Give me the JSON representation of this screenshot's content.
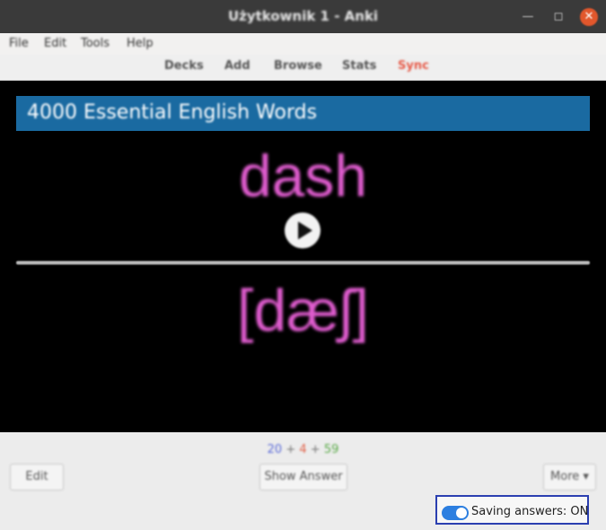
{
  "window": {
    "title": "Użytkownik 1 - Anki"
  },
  "menu": {
    "items": [
      "File",
      "Edit",
      "Tools",
      "Help"
    ]
  },
  "toolbar": {
    "decks": "Decks",
    "add": "Add",
    "browse": "Browse",
    "stats": "Stats",
    "sync": "Sync"
  },
  "card": {
    "deck_title": "4000 Essential English Words",
    "word": "dash",
    "pronunciation": "[dæʃ]"
  },
  "counts": {
    "new": "20",
    "learning": "4",
    "review": "59",
    "separator": "+"
  },
  "buttons": {
    "edit": "Edit",
    "show_answer": "Show Answer",
    "more": "More ▾"
  },
  "saving": {
    "label": "Saving answers: ON",
    "enabled": true
  },
  "colors": {
    "deck_bar": "#1a6aa1",
    "card_text": "#e05ccf",
    "sync": "#e65c4a",
    "toggle": "#2d7fe0"
  }
}
